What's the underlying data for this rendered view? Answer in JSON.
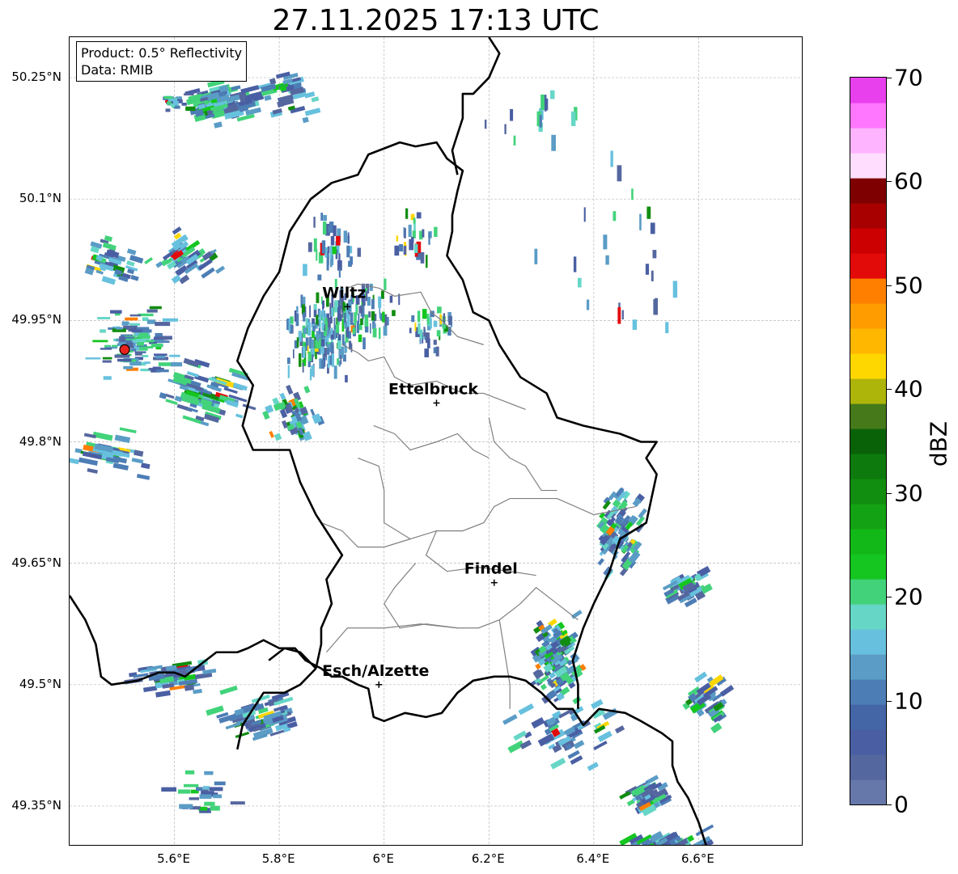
{
  "title": "27.11.2025 17:13 UTC",
  "info": {
    "product": "Product: 0.5° Reflectivity",
    "data": "Data: RMIB"
  },
  "extent": {
    "lon_min": 5.4,
    "lon_max": 6.8,
    "lat_min": 49.3,
    "lat_max": 50.3
  },
  "lat_ticks": [
    {
      "value": 50.25,
      "label": "50.25°N"
    },
    {
      "value": 50.1,
      "label": "50.1°N"
    },
    {
      "value": 49.95,
      "label": "49.95°N"
    },
    {
      "value": 49.8,
      "label": "49.8°N"
    },
    {
      "value": 49.65,
      "label": "49.65°N"
    },
    {
      "value": 49.5,
      "label": "49.5°N"
    },
    {
      "value": 49.35,
      "label": "49.35°N"
    }
  ],
  "lon_ticks": [
    {
      "value": 5.6,
      "label": "5.6°E"
    },
    {
      "value": 5.8,
      "label": "5.8°E"
    },
    {
      "value": 6.0,
      "label": "6°E"
    },
    {
      "value": 6.2,
      "label": "6.2°E"
    },
    {
      "value": 6.4,
      "label": "6.4°E"
    },
    {
      "value": 6.6,
      "label": "6.6°E"
    }
  ],
  "cities": [
    {
      "name": "Wiltz",
      "lon": 5.93,
      "lat": 49.967
    },
    {
      "name": "Ettelbruck",
      "lon": 6.1,
      "lat": 49.848
    },
    {
      "name": "Findel",
      "lon": 6.21,
      "lat": 49.626
    },
    {
      "name": "Esch/Alzette",
      "lon": 5.99,
      "lat": 49.5
    }
  ],
  "radar_site": {
    "lon": 5.505,
    "lat": 49.914,
    "color": "#e8231e"
  },
  "colorbar": {
    "label": "dBZ",
    "min": 0,
    "max": 70,
    "ticks": [
      {
        "value": 0,
        "label": "0"
      },
      {
        "value": 10,
        "label": "10"
      },
      {
        "value": 20,
        "label": "20"
      },
      {
        "value": 30,
        "label": "30"
      },
      {
        "value": 40,
        "label": "40"
      },
      {
        "value": 50,
        "label": "50"
      },
      {
        "value": 60,
        "label": "60"
      },
      {
        "value": 70,
        "label": "70"
      }
    ],
    "colors": [
      "#6677aa",
      "#55679f",
      "#4a5fa3",
      "#4466a6",
      "#4d7db5",
      "#5a9cc6",
      "#67c1de",
      "#66d6c6",
      "#42d37a",
      "#14c61f",
      "#12b818",
      "#13a213",
      "#118d10",
      "#0d7a0d",
      "#0a6208",
      "#45791a",
      "#adb40a",
      "#ffd700",
      "#ffb700",
      "#ff9d00",
      "#ff7f00",
      "#e30a0a",
      "#cc0000",
      "#a80000",
      "#7e0000",
      "#ffddff",
      "#ffb4ff",
      "#ff77ff",
      "#e840ec"
    ]
  },
  "echo_colors": [
    "#4a5fa3",
    "#55679f",
    "#5a9cc6",
    "#4d7db5",
    "#67c1de",
    "#42d37a",
    "#14c61f",
    "#118d10",
    "#66d6c6",
    "#ffd700",
    "#ff7f00",
    "#e30a0a"
  ],
  "echo_clusters": [
    {
      "lon": 5.69,
      "lat": 50.22,
      "rx": 0.12,
      "ry": 0.03,
      "n": 80,
      "tilt": -0.25,
      "w": 0.025,
      "h": 0.006
    },
    {
      "lon": 5.6,
      "lat": 50.22,
      "rx": 0.04,
      "ry": 0.015,
      "n": 20,
      "tilt": 0,
      "w": 0.015,
      "h": 0.004
    },
    {
      "lon": 5.83,
      "lat": 50.23,
      "rx": 0.06,
      "ry": 0.04,
      "n": 30,
      "tilt": -0.25,
      "w": 0.02,
      "h": 0.005
    },
    {
      "lon": 5.62,
      "lat": 50.03,
      "rx": 0.08,
      "ry": 0.04,
      "n": 50,
      "tilt": -0.6,
      "w": 0.02,
      "h": 0.005
    },
    {
      "lon": 5.48,
      "lat": 50.02,
      "rx": 0.07,
      "ry": 0.04,
      "n": 40,
      "tilt": 0.3,
      "w": 0.02,
      "h": 0.005
    },
    {
      "lon": 5.52,
      "lat": 49.92,
      "rx": 0.1,
      "ry": 0.06,
      "n": 110,
      "tilt": 0,
      "w": 0.02,
      "h": 0.004
    },
    {
      "lon": 5.66,
      "lat": 49.86,
      "rx": 0.1,
      "ry": 0.05,
      "n": 80,
      "tilt": 0.3,
      "w": 0.025,
      "h": 0.005
    },
    {
      "lon": 5.48,
      "lat": 49.79,
      "rx": 0.1,
      "ry": 0.04,
      "n": 40,
      "tilt": 0.2,
      "w": 0.025,
      "h": 0.005
    },
    {
      "lon": 5.88,
      "lat": 49.93,
      "rx": 0.08,
      "ry": 0.06,
      "n": 160,
      "tilt": 0,
      "w": 0.005,
      "h": 0.012
    },
    {
      "lon": 5.95,
      "lat": 49.96,
      "rx": 0.1,
      "ry": 0.05,
      "n": 100,
      "tilt": 0,
      "w": 0.005,
      "h": 0.012
    },
    {
      "lon": 5.83,
      "lat": 49.83,
      "rx": 0.06,
      "ry": 0.04,
      "n": 60,
      "tilt": -0.4,
      "w": 0.01,
      "h": 0.008
    },
    {
      "lon": 5.9,
      "lat": 50.04,
      "rx": 0.07,
      "ry": 0.05,
      "n": 40,
      "tilt": 0,
      "w": 0.006,
      "h": 0.012
    },
    {
      "lon": 6.06,
      "lat": 50.05,
      "rx": 0.06,
      "ry": 0.05,
      "n": 30,
      "tilt": 0,
      "w": 0.006,
      "h": 0.012
    },
    {
      "lon": 6.1,
      "lat": 49.94,
      "rx": 0.06,
      "ry": 0.04,
      "n": 40,
      "tilt": 0,
      "w": 0.006,
      "h": 0.01
    },
    {
      "lon": 6.33,
      "lat": 49.53,
      "rx": 0.06,
      "ry": 0.07,
      "n": 160,
      "tilt": -0.6,
      "w": 0.015,
      "h": 0.006
    },
    {
      "lon": 6.45,
      "lat": 49.69,
      "rx": 0.06,
      "ry": 0.07,
      "n": 110,
      "tilt": -0.9,
      "w": 0.015,
      "h": 0.006
    },
    {
      "lon": 6.58,
      "lat": 49.62,
      "rx": 0.06,
      "ry": 0.025,
      "n": 40,
      "tilt": -0.5,
      "w": 0.02,
      "h": 0.006
    },
    {
      "lon": 6.62,
      "lat": 49.48,
      "rx": 0.05,
      "ry": 0.04,
      "n": 40,
      "tilt": -0.6,
      "w": 0.02,
      "h": 0.006
    },
    {
      "lon": 6.5,
      "lat": 49.36,
      "rx": 0.06,
      "ry": 0.025,
      "n": 50,
      "tilt": -0.5,
      "w": 0.02,
      "h": 0.006
    },
    {
      "lon": 6.54,
      "lat": 49.3,
      "rx": 0.1,
      "ry": 0.025,
      "n": 60,
      "tilt": -0.5,
      "w": 0.025,
      "h": 0.006
    },
    {
      "lon": 5.76,
      "lat": 49.46,
      "rx": 0.12,
      "ry": 0.04,
      "n": 60,
      "tilt": -0.3,
      "w": 0.025,
      "h": 0.005
    },
    {
      "lon": 5.6,
      "lat": 49.51,
      "rx": 0.12,
      "ry": 0.03,
      "n": 50,
      "tilt": -0.15,
      "w": 0.025,
      "h": 0.005
    },
    {
      "lon": 5.65,
      "lat": 49.37,
      "rx": 0.08,
      "ry": 0.04,
      "n": 25,
      "tilt": 0,
      "w": 0.02,
      "h": 0.005
    },
    {
      "lon": 6.35,
      "lat": 49.44,
      "rx": 0.15,
      "ry": 0.06,
      "n": 50,
      "tilt": -0.5,
      "w": 0.02,
      "h": 0.006
    },
    {
      "lon": 6.45,
      "lat": 50.03,
      "rx": 0.2,
      "ry": 0.2,
      "n": 25,
      "tilt": 0,
      "w": 0.006,
      "h": 0.015
    },
    {
      "lon": 6.3,
      "lat": 50.2,
      "rx": 0.15,
      "ry": 0.06,
      "n": 15,
      "tilt": 0,
      "w": 0.006,
      "h": 0.015
    }
  ],
  "admin_lines": [
    [
      [
        5.93,
        49.99
      ],
      [
        5.95,
        49.995
      ],
      [
        5.99,
        49.99
      ],
      [
        6.02,
        49.98
      ],
      [
        6.07,
        49.985
      ],
      [
        6.09,
        49.96
      ],
      [
        6.11,
        49.95
      ],
      [
        6.14,
        49.93
      ],
      [
        6.19,
        49.92
      ]
    ],
    [
      [
        5.92,
        49.92
      ],
      [
        5.95,
        49.91
      ],
      [
        5.97,
        49.9
      ],
      [
        6.0,
        49.905
      ],
      [
        6.02,
        49.88
      ],
      [
        6.05,
        49.87
      ],
      [
        6.1,
        49.875
      ],
      [
        6.15,
        49.86
      ],
      [
        6.19,
        49.86
      ],
      [
        6.23,
        49.85
      ],
      [
        6.27,
        49.84
      ]
    ],
    [
      [
        5.98,
        49.82
      ],
      [
        6.02,
        49.81
      ],
      [
        6.05,
        49.79
      ],
      [
        6.1,
        49.8
      ],
      [
        6.14,
        49.81
      ],
      [
        6.17,
        49.79
      ],
      [
        6.2,
        49.78
      ]
    ],
    [
      [
        6.2,
        49.83
      ],
      [
        6.21,
        49.8
      ],
      [
        6.24,
        49.78
      ],
      [
        6.27,
        49.77
      ],
      [
        6.3,
        49.74
      ],
      [
        6.33,
        49.74
      ]
    ],
    [
      [
        5.95,
        49.78
      ],
      [
        5.99,
        49.77
      ],
      [
        6.0,
        49.74
      ],
      [
        6.0,
        49.7
      ],
      [
        6.05,
        49.68
      ],
      [
        6.1,
        49.69
      ],
      [
        6.15,
        49.69
      ],
      [
        6.19,
        49.7
      ],
      [
        6.21,
        49.72
      ],
      [
        6.24,
        49.73
      ],
      [
        6.3,
        49.73
      ],
      [
        6.33,
        49.73
      ],
      [
        6.4,
        49.71
      ],
      [
        6.48,
        49.72
      ]
    ],
    [
      [
        5.88,
        49.7
      ],
      [
        5.92,
        49.69
      ],
      [
        5.95,
        49.67
      ],
      [
        6.0,
        49.67
      ],
      [
        6.05,
        49.68
      ]
    ],
    [
      [
        6.1,
        49.69
      ],
      [
        6.08,
        49.66
      ],
      [
        6.12,
        49.64
      ],
      [
        6.18,
        49.645
      ],
      [
        6.24,
        49.64
      ],
      [
        6.29,
        49.635
      ]
    ],
    [
      [
        6.06,
        49.65
      ],
      [
        6.02,
        49.62
      ],
      [
        6.0,
        49.6
      ],
      [
        6.03,
        49.57
      ],
      [
        6.08,
        49.575
      ],
      [
        6.14,
        49.57
      ],
      [
        6.18,
        49.57
      ],
      [
        6.22,
        49.58
      ]
    ],
    [
      [
        6.22,
        49.58
      ],
      [
        6.26,
        49.6
      ],
      [
        6.29,
        49.62
      ],
      [
        6.33,
        49.6
      ],
      [
        6.37,
        49.58
      ]
    ],
    [
      [
        5.89,
        49.54
      ],
      [
        5.93,
        49.57
      ],
      [
        6.0,
        49.57
      ],
      [
        6.07,
        49.575
      ],
      [
        6.14,
        49.57
      ]
    ],
    [
      [
        6.22,
        49.58
      ],
      [
        6.23,
        49.54
      ],
      [
        6.24,
        49.5
      ],
      [
        6.24,
        49.47
      ]
    ]
  ],
  "borders": [
    [
      [
        5.4,
        49.61
      ],
      [
        5.43,
        49.58
      ],
      [
        5.45,
        49.55
      ],
      [
        5.46,
        49.51
      ],
      [
        5.48,
        49.5
      ],
      [
        5.53,
        49.505
      ],
      [
        5.57,
        49.515
      ],
      [
        5.6,
        49.515
      ],
      [
        5.62,
        49.51
      ],
      [
        5.64,
        49.52
      ],
      [
        5.68,
        49.54
      ],
      [
        5.72,
        49.54
      ],
      [
        5.74,
        49.545
      ],
      [
        5.77,
        49.555
      ],
      [
        5.8,
        49.545
      ],
      [
        5.83,
        49.545
      ],
      [
        5.85,
        49.53
      ],
      [
        5.88,
        49.52
      ],
      [
        5.9,
        49.51
      ],
      [
        5.92,
        49.51
      ],
      [
        5.95,
        49.5
      ],
      [
        5.97,
        49.495
      ],
      [
        5.98,
        49.46
      ],
      [
        6.0,
        49.455
      ],
      [
        6.04,
        49.465
      ],
      [
        6.08,
        49.46
      ],
      [
        6.11,
        49.465
      ],
      [
        6.14,
        49.49
      ],
      [
        6.17,
        49.505
      ],
      [
        6.21,
        49.51
      ],
      [
        6.24,
        49.51
      ],
      [
        6.27,
        49.505
      ],
      [
        6.3,
        49.49
      ],
      [
        6.33,
        49.47
      ],
      [
        6.36,
        49.47
      ],
      [
        6.38,
        49.45
      ],
      [
        6.41,
        49.47
      ],
      [
        6.46,
        49.465
      ],
      [
        6.49,
        49.455
      ],
      [
        6.53,
        49.44
      ],
      [
        6.55,
        49.43
      ],
      [
        6.55,
        49.4
      ],
      [
        6.56,
        49.38
      ],
      [
        6.58,
        49.36
      ],
      [
        6.6,
        49.33
      ],
      [
        6.62,
        49.29
      ]
    ],
    [
      [
        5.72,
        49.42
      ],
      [
        5.73,
        49.45
      ],
      [
        5.75,
        49.47
      ],
      [
        5.77,
        49.49
      ],
      [
        5.81,
        49.49
      ],
      [
        5.84,
        49.5
      ],
      [
        5.87,
        49.52
      ]
    ],
    [
      [
        5.78,
        49.53
      ],
      [
        5.81,
        49.545
      ],
      [
        5.84,
        49.54
      ],
      [
        5.87,
        49.52
      ]
    ],
    [
      [
        5.87,
        49.52
      ],
      [
        5.88,
        49.55
      ],
      [
        5.88,
        49.57
      ],
      [
        5.9,
        49.6
      ],
      [
        5.89,
        49.63
      ],
      [
        5.92,
        49.66
      ],
      [
        5.89,
        49.69
      ],
      [
        5.87,
        49.71
      ],
      [
        5.84,
        49.75
      ],
      [
        5.82,
        49.79
      ],
      [
        5.75,
        49.79
      ],
      [
        5.73,
        49.82
      ],
      [
        5.75,
        49.87
      ],
      [
        5.72,
        49.9
      ],
      [
        5.74,
        49.94
      ],
      [
        5.77,
        49.98
      ],
      [
        5.8,
        50.01
      ],
      [
        5.82,
        50.06
      ],
      [
        5.86,
        50.1
      ],
      [
        5.9,
        50.12
      ],
      [
        5.95,
        50.13
      ],
      [
        5.97,
        50.155
      ],
      [
        6.03,
        50.17
      ],
      [
        6.06,
        50.165
      ],
      [
        6.1,
        50.17
      ],
      [
        6.12,
        50.15
      ],
      [
        6.15,
        50.135
      ],
      [
        6.14,
        50.11
      ],
      [
        6.13,
        50.08
      ],
      [
        6.13,
        50.06
      ],
      [
        6.12,
        50.03
      ],
      [
        6.15,
        50.0
      ],
      [
        6.17,
        49.96
      ],
      [
        6.2,
        49.95
      ],
      [
        6.22,
        49.92
      ],
      [
        6.26,
        49.88
      ],
      [
        6.31,
        49.86
      ],
      [
        6.33,
        49.83
      ],
      [
        6.38,
        49.82
      ],
      [
        6.45,
        49.81
      ],
      [
        6.49,
        49.8
      ],
      [
        6.52,
        49.8
      ],
      [
        6.5,
        49.78
      ],
      [
        6.52,
        49.76
      ],
      [
        6.51,
        49.73
      ],
      [
        6.5,
        49.7
      ],
      [
        6.45,
        49.68
      ],
      [
        6.43,
        49.64
      ],
      [
        6.4,
        49.6
      ],
      [
        6.38,
        49.57
      ],
      [
        6.37,
        49.55
      ],
      [
        6.36,
        49.53
      ],
      [
        6.37,
        49.5
      ],
      [
        6.37,
        49.47
      ]
    ],
    [
      [
        6.2,
        50.3
      ],
      [
        6.22,
        50.28
      ],
      [
        6.2,
        50.25
      ],
      [
        6.17,
        50.23
      ],
      [
        6.15,
        50.23
      ],
      [
        6.15,
        50.2
      ],
      [
        6.14,
        50.18
      ],
      [
        6.13,
        50.16
      ],
      [
        6.14,
        50.13
      ]
    ]
  ]
}
